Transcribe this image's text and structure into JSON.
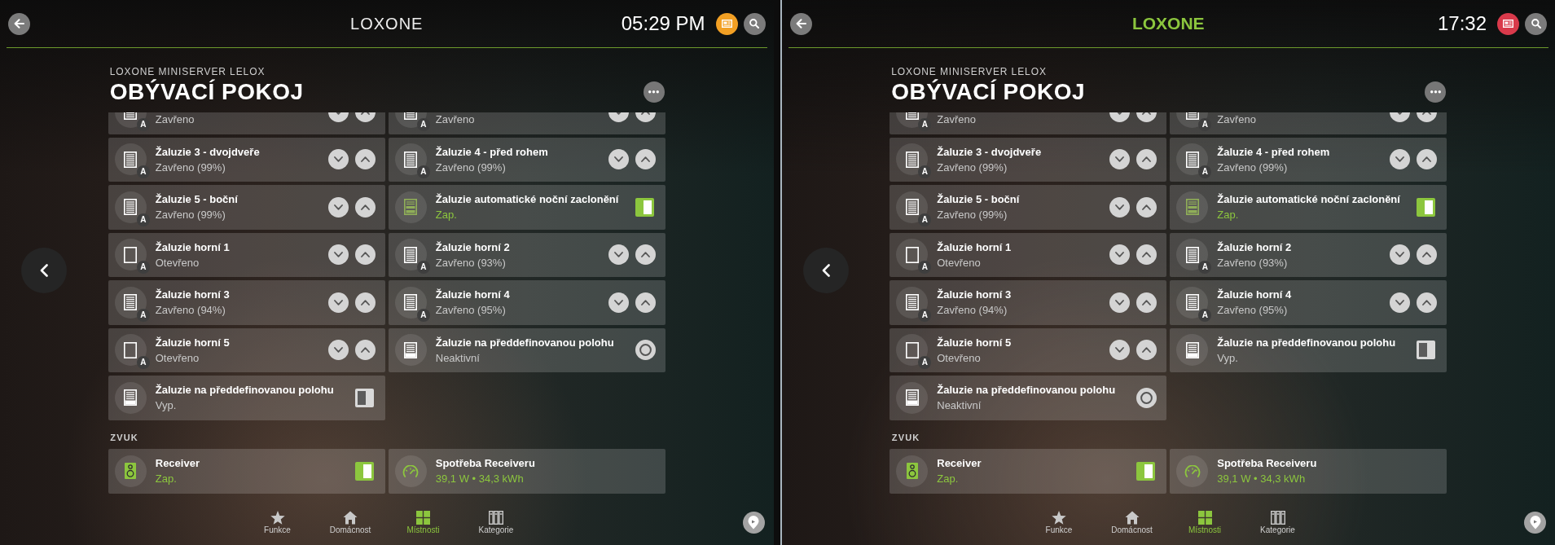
{
  "screens": [
    {
      "header": {
        "logo": {
          "text": "LOXONE",
          "kind": "thin"
        },
        "time": "05:29 PM",
        "notification": {
          "color": "#f2a024"
        }
      },
      "subtitle": "LOXONE MINISERVER LELOX",
      "title": "OBÝVACÍ POKOJ",
      "sections": [
        {
          "cards": [
            {
              "kind": "blind",
              "status": "Zavřeno",
              "active": false,
              "closed": true,
              "badge": "A",
              "control": {
                "kind": "updown"
              }
            },
            {
              "kind": "blind",
              "status": "Zavřeno",
              "active": false,
              "closed": true,
              "badge": "A",
              "control": {
                "kind": "updown"
              }
            },
            {
              "kind": "blind",
              "title": "Žaluzie 3 - dvojdveře",
              "status": "Zavřeno (99%)",
              "active": false,
              "closed": true,
              "badge": "A",
              "control": {
                "kind": "updown"
              }
            },
            {
              "kind": "blind",
              "title": "Žaluzie 4 - před rohem",
              "status": "Zavřeno (99%)",
              "active": false,
              "closed": true,
              "badge": "A",
              "control": {
                "kind": "updown"
              }
            },
            {
              "kind": "blind",
              "title": "Žaluzie 5 - boční",
              "status": "Zavřeno (99%)",
              "active": false,
              "closed": true,
              "badge": "A",
              "control": {
                "kind": "updown"
              }
            },
            {
              "kind": "shading",
              "title": "Žaluzie automatické noční zaclonění",
              "status": "Zap.",
              "active": true,
              "control": {
                "kind": "switch",
                "on": true
              }
            },
            {
              "kind": "blind",
              "title": "Žaluzie horní 1",
              "status": "Otevřeno",
              "active": false,
              "closed": false,
              "badge": "A",
              "control": {
                "kind": "updown"
              }
            },
            {
              "kind": "blind",
              "title": "Žaluzie horní 2",
              "status": "Zavřeno (93%)",
              "active": false,
              "closed": true,
              "badge": "A",
              "control": {
                "kind": "updown"
              }
            },
            {
              "kind": "blind",
              "title": "Žaluzie horní 3",
              "status": "Zavřeno (94%)",
              "active": false,
              "closed": true,
              "badge": "A",
              "control": {
                "kind": "updown"
              }
            },
            {
              "kind": "blind",
              "title": "Žaluzie horní 4",
              "status": "Zavřeno (95%)",
              "active": false,
              "closed": true,
              "badge": "A",
              "control": {
                "kind": "updown"
              }
            },
            {
              "kind": "blind",
              "title": "Žaluzie horní 5",
              "status": "Otevřeno",
              "active": false,
              "closed": false,
              "badge": "A",
              "control": {
                "kind": "updown"
              }
            },
            {
              "kind": "preset",
              "title": "Žaluzie na předdefinovanou polohu",
              "status": "Neaktivní",
              "active": false,
              "control": {
                "kind": "button"
              }
            },
            {
              "kind": "preset",
              "title": "Žaluzie na předdefinovanou polohu",
              "status": "Vyp.",
              "active": false,
              "control": {
                "kind": "switch",
                "on": false
              }
            }
          ]
        },
        {
          "title": "ZVUK",
          "cards": [
            {
              "kind": "speaker",
              "title": "Receiver",
              "status": "Zap.",
              "active": true,
              "control": {
                "kind": "switch",
                "on": true
              }
            },
            {
              "kind": "meter",
              "title": "Spotřeba Receiveru",
              "status": "39,1 W • 34,3 kWh",
              "active": true
            }
          ]
        }
      ],
      "tabs": [
        {
          "label": "Funkce",
          "selected": false
        },
        {
          "label": "Domácnost",
          "selected": false
        },
        {
          "label": "Místnosti",
          "selected": true
        },
        {
          "label": "Kategorie",
          "selected": false
        }
      ]
    },
    {
      "header": {
        "logo": {
          "text": "LOXONE",
          "kind": "bold"
        },
        "time": "17:32",
        "notification": {
          "color": "#d93a4b"
        }
      },
      "subtitle": "LOXONE MINISERVER LELOX",
      "title": "OBÝVACÍ POKOJ",
      "sections": [
        {
          "cards": [
            {
              "kind": "blind",
              "status": "Zavřeno",
              "active": false,
              "closed": true,
              "badge": "A",
              "control": {
                "kind": "updown"
              }
            },
            {
              "kind": "blind",
              "status": "Zavřeno",
              "active": false,
              "closed": true,
              "badge": "A",
              "control": {
                "kind": "updown"
              }
            },
            {
              "kind": "blind",
              "title": "Žaluzie 3 - dvojdveře",
              "status": "Zavřeno (99%)",
              "active": false,
              "closed": true,
              "badge": "A",
              "control": {
                "kind": "updown"
              }
            },
            {
              "kind": "blind",
              "title": "Žaluzie 4 - před rohem",
              "status": "Zavřeno (99%)",
              "active": false,
              "closed": true,
              "badge": "A",
              "control": {
                "kind": "updown"
              }
            },
            {
              "kind": "blind",
              "title": "Žaluzie 5 - boční",
              "status": "Zavřeno (99%)",
              "active": false,
              "closed": true,
              "badge": "A",
              "control": {
                "kind": "updown"
              }
            },
            {
              "kind": "shading",
              "title": "Žaluzie automatické noční zaclonění",
              "status": "Zap.",
              "active": true,
              "control": {
                "kind": "switch",
                "on": true
              }
            },
            {
              "kind": "blind",
              "title": "Žaluzie horní 1",
              "status": "Otevřeno",
              "active": false,
              "closed": false,
              "badge": "A",
              "control": {
                "kind": "updown"
              }
            },
            {
              "kind": "blind",
              "title": "Žaluzie horní 2",
              "status": "Zavřeno (93%)",
              "active": false,
              "closed": true,
              "badge": "A",
              "control": {
                "kind": "updown"
              }
            },
            {
              "kind": "blind",
              "title": "Žaluzie horní 3",
              "status": "Zavřeno (94%)",
              "active": false,
              "closed": true,
              "badge": "A",
              "control": {
                "kind": "updown"
              }
            },
            {
              "kind": "blind",
              "title": "Žaluzie horní 4",
              "status": "Zavřeno (95%)",
              "active": false,
              "closed": true,
              "badge": "A",
              "control": {
                "kind": "updown"
              }
            },
            {
              "kind": "blind",
              "title": "Žaluzie horní 5",
              "status": "Otevřeno",
              "active": false,
              "closed": false,
              "badge": "A",
              "control": {
                "kind": "updown"
              }
            },
            {
              "kind": "preset",
              "title": "Žaluzie na předdefinovanou polohu",
              "status": "Vyp.",
              "active": false,
              "control": {
                "kind": "switch",
                "on": false
              }
            },
            {
              "kind": "preset",
              "title": "Žaluzie na předdefinovanou polohu",
              "status": "Neaktivní",
              "active": false,
              "control": {
                "kind": "button"
              }
            }
          ]
        },
        {
          "title": "ZVUK",
          "cards": [
            {
              "kind": "speaker",
              "title": "Receiver",
              "status": "Zap.",
              "active": true,
              "control": {
                "kind": "switch",
                "on": true
              }
            },
            {
              "kind": "meter",
              "title": "Spotřeba Receiveru",
              "status": "39,1 W • 34,3 kWh",
              "active": true
            }
          ]
        }
      ],
      "tabs": [
        {
          "label": "Funkce",
          "selected": false
        },
        {
          "label": "Domácnost",
          "selected": false
        },
        {
          "label": "Místnosti",
          "selected": true
        },
        {
          "label": "Kategorie",
          "selected": false
        }
      ]
    }
  ]
}
